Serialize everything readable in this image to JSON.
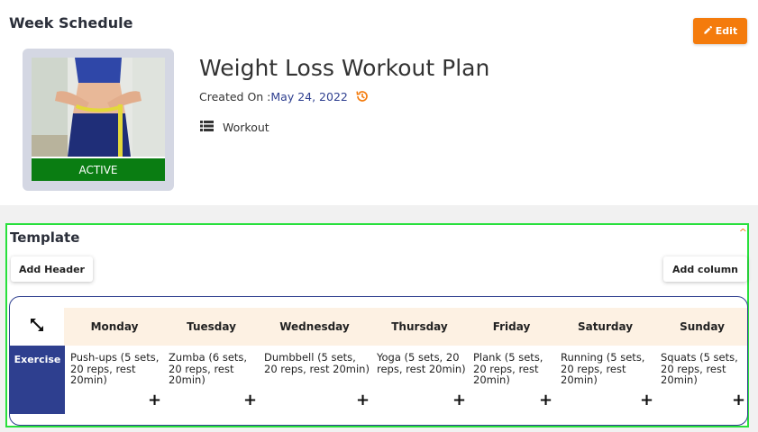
{
  "header": {
    "title": "Week Schedule",
    "edit_label": "Edit"
  },
  "plan": {
    "status": "ACTIVE",
    "title": "Weight Loss Workout Plan",
    "created_label": "Created On :",
    "created_date": "May 24, 2022",
    "category": "Workout"
  },
  "template": {
    "title": "Template",
    "add_header_label": "Add Header",
    "add_column_label": "Add column",
    "days": [
      "Monday",
      "Tuesday",
      "Wednesday",
      "Thursday",
      "Friday",
      "Saturday",
      "Sunday"
    ],
    "rows": [
      {
        "label": "Exercise",
        "cells": [
          "Push-ups (5 sets, 20 reps, rest 20min)",
          "Zumba (6 sets, 20 reps, rest 20min)",
          "Dumbbell (5 sets, 20 reps, rest 20min)",
          "Yoga (5 sets, 20 reps, rest 20min)",
          "Plank (5 sets, 20 reps, rest 20min)",
          "Running (5 sets, 20 reps, rest 20min)",
          "Squats (5 sets, 20 reps, rest 20min)"
        ]
      }
    ]
  },
  "colors": {
    "accent": "#f47b0c",
    "primary": "#2e3f8f",
    "active": "#0a7d12",
    "highlight": "#28e03c"
  }
}
